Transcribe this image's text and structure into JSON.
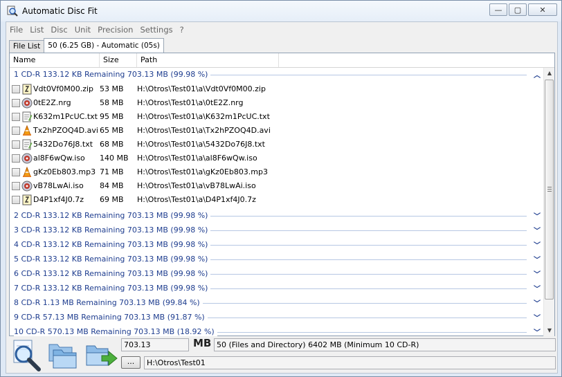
{
  "window": {
    "title": "Automatic Disc Fit",
    "minimize": "—",
    "maximize": "▢",
    "close": "✕"
  },
  "menu": [
    "File",
    "List",
    "Disc",
    "Unit",
    "Precision",
    "Settings",
    "?"
  ],
  "tabs": [
    "File List",
    "50 (6.25 GB) - Automatic (05s)"
  ],
  "columns": [
    "Name",
    "Size",
    "Path"
  ],
  "groups": [
    {
      "label": "1 CD-R 133.12 KB Remaining 703.13 MB (99.98 %)",
      "expanded": true
    },
    {
      "label": "2 CD-R 133.12 KB Remaining 703.13 MB (99.98 %)",
      "expanded": false
    },
    {
      "label": "3 CD-R 133.12 KB Remaining 703.13 MB (99.98 %)",
      "expanded": false
    },
    {
      "label": "4 CD-R 133.12 KB Remaining 703.13 MB (99.98 %)",
      "expanded": false
    },
    {
      "label": "5 CD-R 133.12 KB Remaining 703.13 MB (99.98 %)",
      "expanded": false
    },
    {
      "label": "6 CD-R 133.12 KB Remaining 703.13 MB (99.98 %)",
      "expanded": false
    },
    {
      "label": "7 CD-R 133.12 KB Remaining 703.13 MB (99.98 %)",
      "expanded": false
    },
    {
      "label": "8 CD-R 1.13 MB Remaining 703.13 MB (99.84 %)",
      "expanded": false
    },
    {
      "label": "9 CD-R 57.13 MB Remaining 703.13 MB (91.87 %)",
      "expanded": false
    },
    {
      "label": "10 CD-R 570.13 MB Remaining 703.13 MB (18.92 %)",
      "expanded": false
    }
  ],
  "files": [
    {
      "name": "Vdt0Vf0M00.zip",
      "size": "53 MB",
      "path": "H:\\Otros\\Test01\\a\\Vdt0Vf0M00.zip",
      "icon": "zip-icon"
    },
    {
      "name": "0tE2Z.nrg",
      "size": "58 MB",
      "path": "H:\\Otros\\Test01\\a\\0tE2Z.nrg",
      "icon": "disc-image-icon"
    },
    {
      "name": "K632m1PcUC.txt",
      "size": "95 MB",
      "path": "H:\\Otros\\Test01\\a\\K632m1PcUC.txt",
      "icon": "text-file-icon"
    },
    {
      "name": "Tx2hPZOQ4D.avi",
      "size": "65 MB",
      "path": "H:\\Otros\\Test01\\a\\Tx2hPZOQ4D.avi",
      "icon": "vlc-cone-icon"
    },
    {
      "name": "5432Do76J8.txt",
      "size": "68 MB",
      "path": "H:\\Otros\\Test01\\a\\5432Do76J8.txt",
      "icon": "text-file-icon"
    },
    {
      "name": "al8F6wQw.iso",
      "size": "140 MB",
      "path": "H:\\Otros\\Test01\\a\\al8F6wQw.iso",
      "icon": "disc-image-icon"
    },
    {
      "name": "gKz0Eb803.mp3",
      "size": "71 MB",
      "path": "H:\\Otros\\Test01\\a\\gKz0Eb803.mp3",
      "icon": "vlc-cone-icon"
    },
    {
      "name": "vB78LwAi.iso",
      "size": "84 MB",
      "path": "H:\\Otros\\Test01\\a\\vB78LwAi.iso",
      "icon": "disc-image-icon"
    },
    {
      "name": "D4P1xf4J0.7z",
      "size": "69 MB",
      "path": "H:\\Otros\\Test01\\a\\D4P1xf4J0.7z",
      "icon": "zip-icon"
    }
  ],
  "bottom": {
    "capacity_value": "703.13",
    "unit": "MB",
    "summary": "50 (Files and Directory) 6402 MB (Minimum 10 CD-R)",
    "browse_label": "...",
    "folder_path": "H:\\Otros\\Test01"
  },
  "colors": {
    "group_text": "#1e3d8f",
    "group_line": "#b6c7e3"
  }
}
